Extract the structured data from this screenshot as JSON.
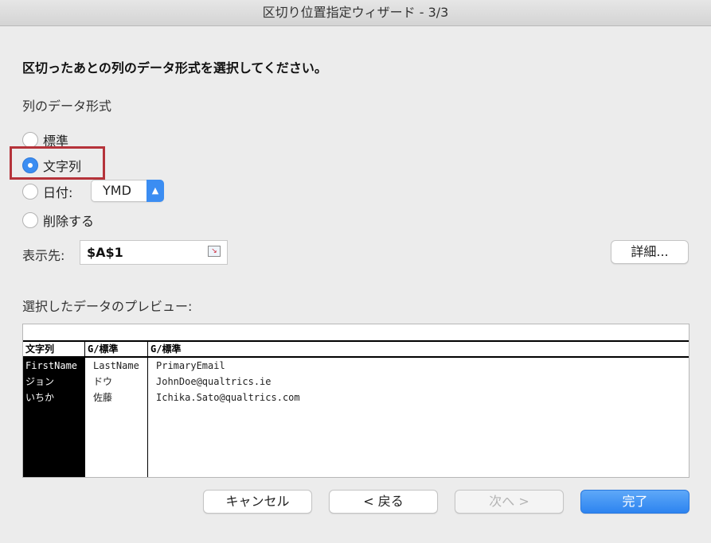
{
  "window": {
    "title": "区切り位置指定ウィザード - 3/3"
  },
  "instruction": "区切ったあとの列のデータ形式を選択してください。",
  "format_section": {
    "label": "列のデータ形式",
    "options": [
      {
        "label": "標準",
        "checked": false
      },
      {
        "label": "文字列",
        "checked": true
      },
      {
        "label": "日付:",
        "checked": false
      },
      {
        "label": "削除する",
        "checked": false
      }
    ],
    "date_format": "YMD"
  },
  "destination": {
    "label": "表示先:",
    "value": "$A$1"
  },
  "advanced_label": "詳細...",
  "preview": {
    "label": "選択したデータのプレビュー:",
    "columns": [
      {
        "header": "文字列",
        "cells": [
          "FirstName",
          "ジョン",
          "いちか"
        ]
      },
      {
        "header": "G/標準",
        "cells": [
          "LastName",
          "ドウ",
          "佐藤"
        ]
      },
      {
        "header": "G/標準",
        "cells": [
          "PrimaryEmail",
          "JohnDoe@qualtrics.ie",
          "Ichika.Sato@qualtrics.com"
        ]
      }
    ]
  },
  "buttons": {
    "cancel": "キャンセル",
    "back": "< 戻る",
    "next": "次へ >",
    "finish": "完了"
  },
  "colors": {
    "accent": "#3b8df2",
    "highlight_border": "#b5333a"
  }
}
